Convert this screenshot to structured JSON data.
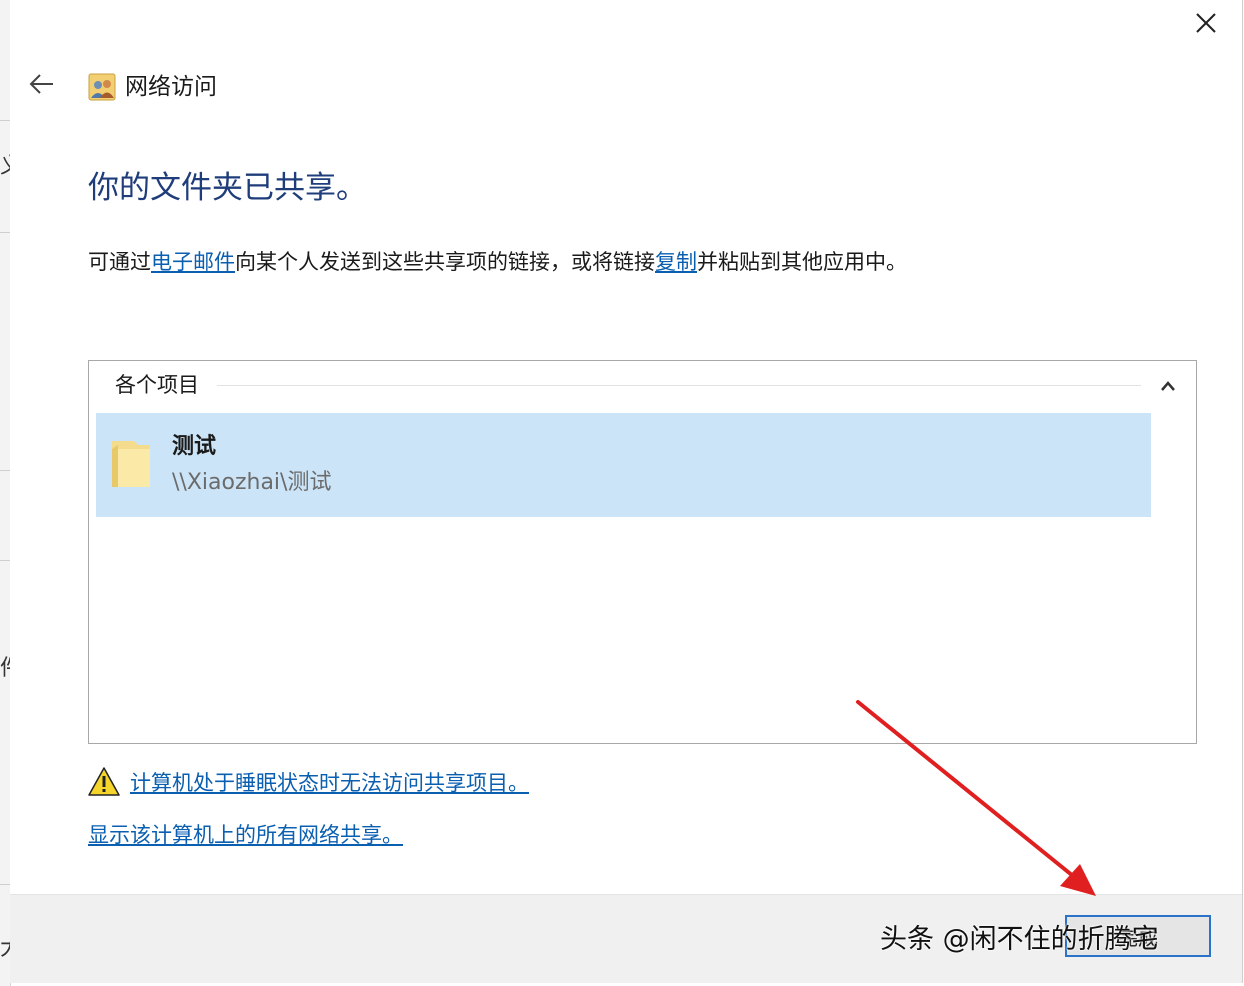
{
  "window": {
    "title": "网络访问",
    "close_glyph": "✕",
    "back_glyph": "←"
  },
  "heading": "你的文件夹已共享。",
  "instruction": {
    "prefix": "可通过",
    "email_link": "电子邮件",
    "middle": "向某个人发送到这些共享项的链接，或将链接",
    "copy_link": "复制",
    "suffix": "并粘贴到其他应用中。"
  },
  "items_group": {
    "header": "各个项目",
    "items": [
      {
        "name": "测试",
        "path": "\\\\Xiaozhai\\测试"
      }
    ]
  },
  "links": {
    "sleep_warning": "计算机处于睡眠状态时无法访问共享项目。",
    "show_all_shares": "显示该计算机上的所有网络共享。"
  },
  "footer": {
    "finish_label": "完成"
  },
  "watermark": "头条 @闲不住的折腾宅",
  "behind_window": {
    "glyphs": [
      "义",
      "件",
      "大"
    ]
  },
  "colors": {
    "heading": "#1f3d7a",
    "link": "#0b5fb0",
    "selection": "#cce4f7",
    "annotation_arrow": "#e02020",
    "footer_bg": "#f0f0f0"
  },
  "icons": [
    "close-icon",
    "back-arrow-icon",
    "network-users-icon",
    "chevron-up-icon",
    "folder-icon",
    "warning-icon"
  ]
}
